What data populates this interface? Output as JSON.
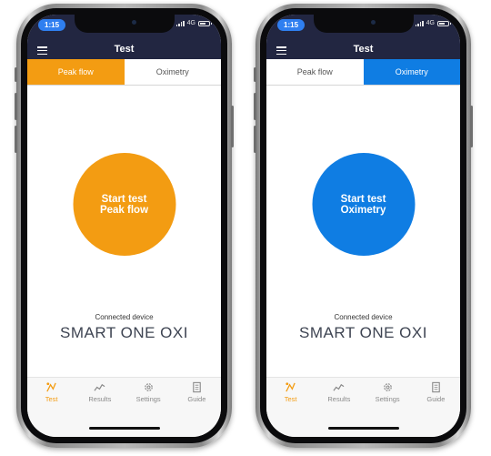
{
  "status": {
    "time": "1:15",
    "network": "4G"
  },
  "nav": {
    "title": "Test"
  },
  "tabs": {
    "peak_flow": "Peak flow",
    "oximetry": "Oximetry"
  },
  "left_screen": {
    "selected_tab": "Peak flow",
    "circle_line1": "Start test",
    "circle_line2": "Peak flow",
    "circle_color": "#f39c12"
  },
  "right_screen": {
    "selected_tab": "Oximetry",
    "circle_line1": "Start test",
    "circle_line2": "Oximetry",
    "circle_color": "#0f7de3"
  },
  "device": {
    "label": "Connected device",
    "name": "SMART ONE OXI"
  },
  "tabbar": [
    {
      "label": "Test",
      "icon": "test-icon"
    },
    {
      "label": "Results",
      "icon": "results-chart-icon"
    },
    {
      "label": "Settings",
      "icon": "gear-icon"
    },
    {
      "label": "Guide",
      "icon": "guide-document-icon"
    }
  ],
  "colors": {
    "header": "#222641",
    "accent_orange": "#f39c12",
    "accent_blue": "#0f7de3",
    "time_pill": "#2f7ff0"
  }
}
